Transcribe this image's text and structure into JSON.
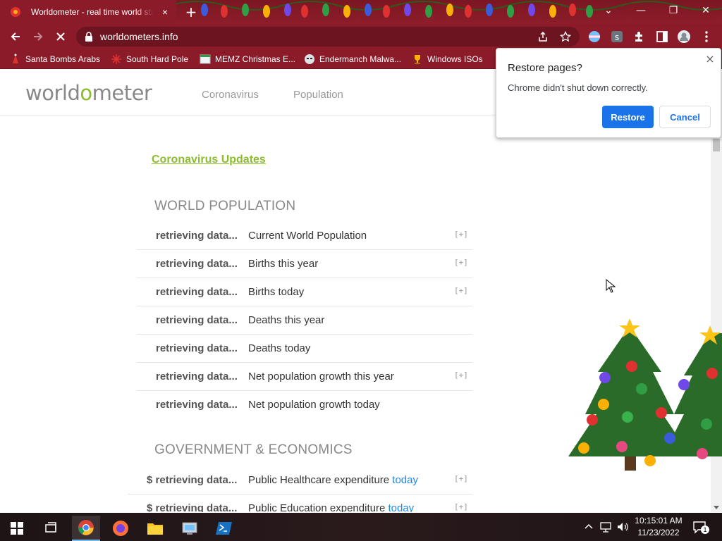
{
  "browser": {
    "tab_title": "Worldometer - real time world statistics",
    "tab_close": "×",
    "new_tab": "+",
    "url": "worldometers.info",
    "window_controls": {
      "collapse": "⌄",
      "minimize": "—",
      "maximize": "❐",
      "close": "✕"
    }
  },
  "bookmarks": [
    {
      "label": "Santa Bombs Arabs"
    },
    {
      "label": "South Hard Pole"
    },
    {
      "label": "MEMZ Christmas E..."
    },
    {
      "label": "Endermanch Malwa..."
    },
    {
      "label": "Windows ISOs"
    }
  ],
  "site": {
    "logo_pre": "world",
    "logo_o": "o",
    "logo_post": "meter",
    "nav": [
      "Coronavirus",
      "Population"
    ],
    "cv_link": "Coronavirus Updates"
  },
  "sections": [
    {
      "title": "WORLD POPULATION",
      "rows": [
        {
          "value": "retrieving data...",
          "label": "Current World Population",
          "expand": "[+]"
        },
        {
          "value": "retrieving data...",
          "label": "Births this year",
          "expand": "[+]"
        },
        {
          "value": "retrieving data...",
          "label": "Births today",
          "expand": "[+]"
        },
        {
          "value": "retrieving data...",
          "label": "Deaths this year",
          "expand": ""
        },
        {
          "value": "retrieving data...",
          "label": "Deaths today",
          "expand": ""
        },
        {
          "value": "retrieving data...",
          "label": "Net population growth this year",
          "expand": "[+]"
        },
        {
          "value": "retrieving data...",
          "label": "Net population growth today",
          "expand": ""
        }
      ]
    },
    {
      "title": "GOVERNMENT & ECONOMICS",
      "rows": [
        {
          "value": "$ retrieving data...",
          "label": "Public Healthcare expenditure",
          "label_blue": "today",
          "expand": "[+]"
        },
        {
          "value": "$ retrieving data...",
          "label": "Public Education expenditure",
          "label_blue": "today",
          "expand": "[+]"
        }
      ]
    }
  ],
  "restore_dialog": {
    "title": "Restore pages?",
    "message": "Chrome didn't shut down correctly.",
    "restore": "Restore",
    "cancel": "Cancel",
    "close": "×"
  },
  "taskbar": {
    "time": "10:15:01 AM",
    "date": "11/23/2022",
    "notification_count": "1"
  },
  "colors": {
    "accent_green": "#8dbd2d",
    "chrome_red": "#8b1b29",
    "restore_blue": "#1a73e8",
    "link_blue": "#1e88e5"
  }
}
